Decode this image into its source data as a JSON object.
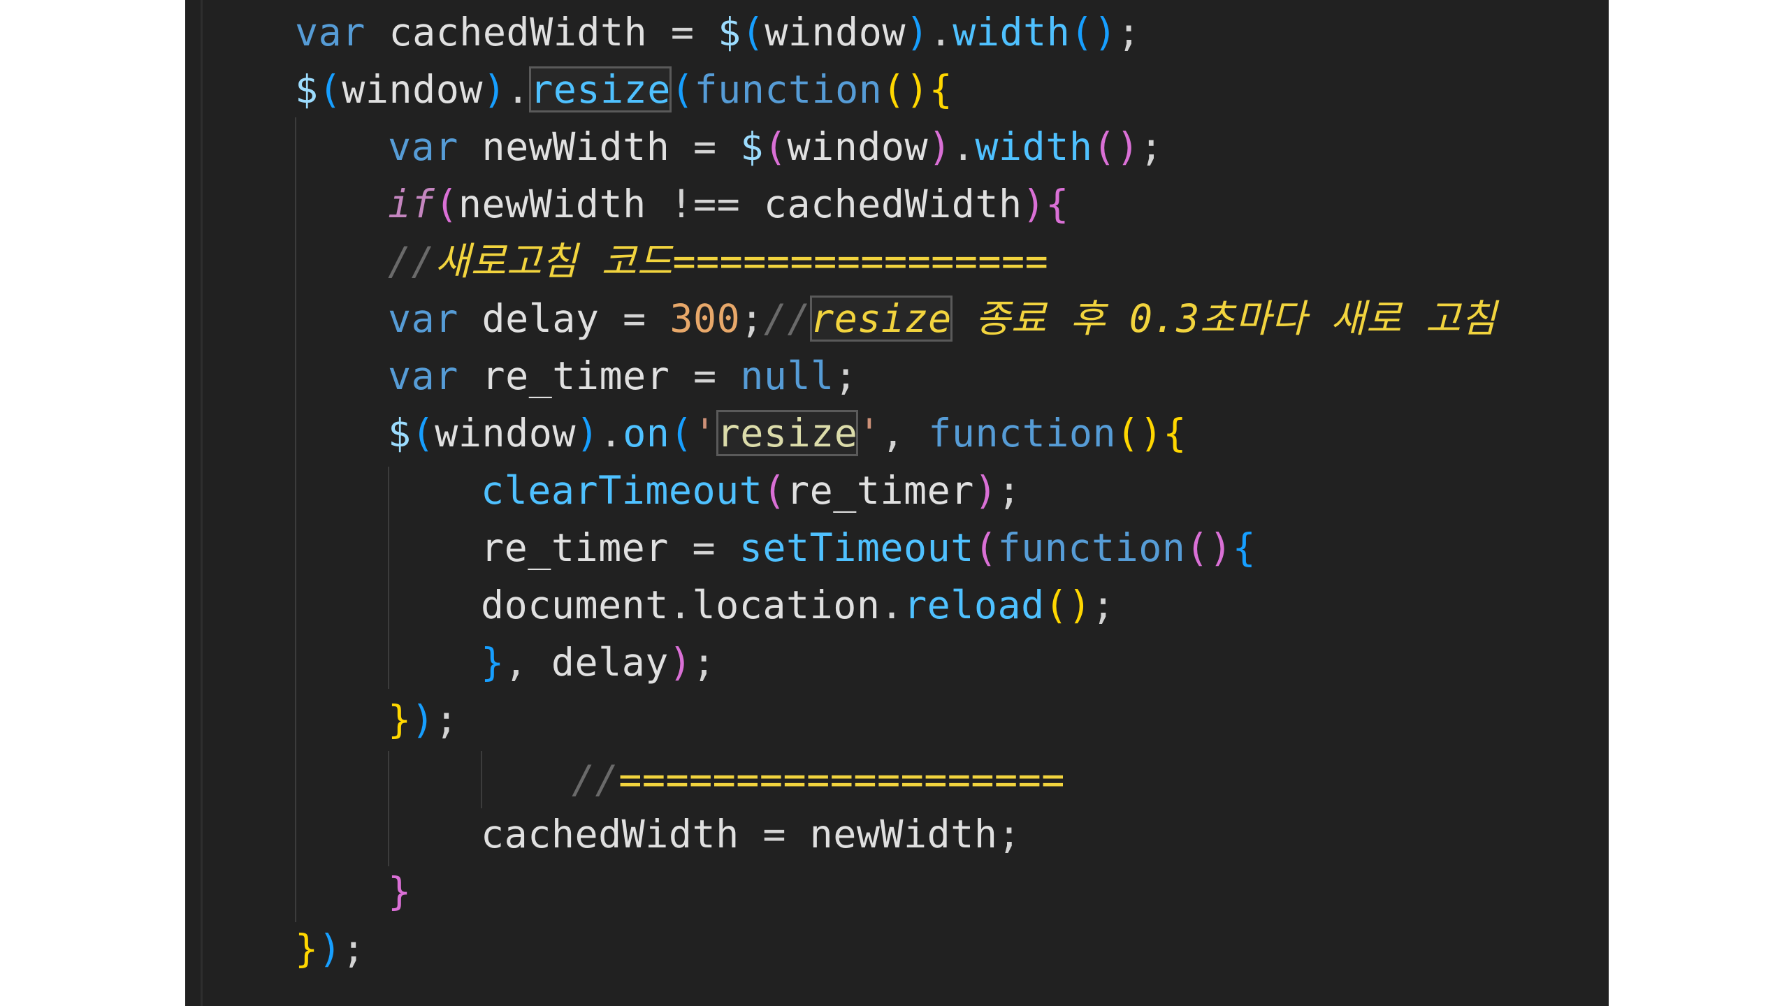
{
  "editor": {
    "lines": [
      {
        "tokens": [
          {
            "t": "var",
            "c": "kw"
          },
          {
            "t": " "
          },
          {
            "t": "cachedWidth",
            "c": "id"
          },
          {
            "t": " = ",
            "c": "op"
          },
          {
            "t": "$",
            "c": "var"
          },
          {
            "t": "(",
            "c": "b3"
          },
          {
            "t": "window",
            "c": "id"
          },
          {
            "t": ")",
            "c": "b3"
          },
          {
            "t": ".",
            "c": "op"
          },
          {
            "t": "width",
            "c": "mt"
          },
          {
            "t": "()",
            "c": "b3"
          },
          {
            "t": ";",
            "c": "op"
          }
        ]
      },
      {
        "tokens": [
          {
            "t": "$",
            "c": "var"
          },
          {
            "t": "(",
            "c": "b3"
          },
          {
            "t": "window",
            "c": "id"
          },
          {
            "t": ")",
            "c": "b3"
          },
          {
            "t": ".",
            "c": "op"
          },
          {
            "t": "resize",
            "c": "mt hl"
          },
          {
            "t": "(",
            "c": "b3"
          },
          {
            "t": "function",
            "c": "kw"
          },
          {
            "t": "()",
            "c": "b1"
          },
          {
            "t": "{",
            "c": "b1"
          }
        ]
      },
      {
        "tokens": [
          {
            "t": "var",
            "c": "kw"
          },
          {
            "t": " "
          },
          {
            "t": "newWidth",
            "c": "id"
          },
          {
            "t": " = ",
            "c": "op"
          },
          {
            "t": "$",
            "c": "var"
          },
          {
            "t": "(",
            "c": "b2"
          },
          {
            "t": "window",
            "c": "id"
          },
          {
            "t": ")",
            "c": "b2"
          },
          {
            "t": ".",
            "c": "op"
          },
          {
            "t": "width",
            "c": "mt"
          },
          {
            "t": "()",
            "c": "b2"
          },
          {
            "t": ";",
            "c": "op"
          }
        ]
      },
      {
        "tokens": [
          {
            "t": "if",
            "c": "ctl"
          },
          {
            "t": "(",
            "c": "b2"
          },
          {
            "t": "newWidth",
            "c": "id"
          },
          {
            "t": " !== ",
            "c": "op"
          },
          {
            "t": "cachedWidth",
            "c": "id"
          },
          {
            "t": ")",
            "c": "b2"
          },
          {
            "t": "{",
            "c": "b2"
          }
        ]
      },
      {
        "tokens": [
          {
            "t": "//",
            "c": "cmd"
          },
          {
            "t": "새로고침 코드================",
            "c": "cm"
          }
        ]
      },
      {
        "tokens": [
          {
            "t": "var",
            "c": "kw"
          },
          {
            "t": " "
          },
          {
            "t": "delay",
            "c": "id"
          },
          {
            "t": " = ",
            "c": "op"
          },
          {
            "t": "300",
            "c": "num"
          },
          {
            "t": ";",
            "c": "op"
          },
          {
            "t": "//",
            "c": "cmd"
          },
          {
            "t": "resize",
            "c": "cm hl"
          },
          {
            "t": " 종료 후 0.3초마다 새로 고침",
            "c": "cm"
          }
        ]
      },
      {
        "tokens": [
          {
            "t": "var",
            "c": "kw"
          },
          {
            "t": " "
          },
          {
            "t": "re_timer",
            "c": "id"
          },
          {
            "t": " = ",
            "c": "op"
          },
          {
            "t": "null",
            "c": "kw"
          },
          {
            "t": ";",
            "c": "op"
          }
        ]
      },
      {
        "tokens": [
          {
            "t": "$",
            "c": "var"
          },
          {
            "t": "(",
            "c": "b3"
          },
          {
            "t": "window",
            "c": "id"
          },
          {
            "t": ")",
            "c": "b3"
          },
          {
            "t": ".",
            "c": "op"
          },
          {
            "t": "on",
            "c": "mt"
          },
          {
            "t": "(",
            "c": "b3"
          },
          {
            "t": "'",
            "c": "str"
          },
          {
            "t": "resize",
            "c": "fn hl"
          },
          {
            "t": "'",
            "c": "str"
          },
          {
            "t": ", ",
            "c": "op"
          },
          {
            "t": "function",
            "c": "kw"
          },
          {
            "t": "()",
            "c": "b1"
          },
          {
            "t": "{",
            "c": "b1"
          }
        ]
      },
      {
        "tokens": [
          {
            "t": "clearTimeout",
            "c": "mt"
          },
          {
            "t": "(",
            "c": "b2"
          },
          {
            "t": "re_timer",
            "c": "id"
          },
          {
            "t": ")",
            "c": "b2"
          },
          {
            "t": ";",
            "c": "op"
          }
        ]
      },
      {
        "tokens": [
          {
            "t": "re_timer",
            "c": "id"
          },
          {
            "t": " = ",
            "c": "op"
          },
          {
            "t": "setTimeout",
            "c": "mt"
          },
          {
            "t": "(",
            "c": "b2"
          },
          {
            "t": "function",
            "c": "kw"
          },
          {
            "t": "()",
            "c": "b2"
          },
          {
            "t": "{",
            "c": "b3"
          }
        ]
      },
      {
        "tokens": [
          {
            "t": "document",
            "c": "id"
          },
          {
            "t": ".",
            "c": "op"
          },
          {
            "t": "location",
            "c": "id"
          },
          {
            "t": ".",
            "c": "op"
          },
          {
            "t": "reload",
            "c": "mt"
          },
          {
            "t": "()",
            "c": "b1"
          },
          {
            "t": ";",
            "c": "op"
          }
        ]
      },
      {
        "tokens": [
          {
            "t": "}",
            "c": "b3"
          },
          {
            "t": ", ",
            "c": "op"
          },
          {
            "t": "delay",
            "c": "id"
          },
          {
            "t": ")",
            "c": "b2"
          },
          {
            "t": ";",
            "c": "op"
          }
        ]
      },
      {
        "tokens": [
          {
            "t": "}",
            "c": "b1"
          },
          {
            "t": ")",
            "c": "b3"
          },
          {
            "t": ";",
            "c": "op"
          }
        ]
      },
      {
        "tokens": [
          {
            "t": "//",
            "c": "cmd"
          },
          {
            "t": "===================",
            "c": "cm"
          }
        ]
      },
      {
        "tokens": [
          {
            "t": "cachedWidth",
            "c": "id"
          },
          {
            "t": " = ",
            "c": "op"
          },
          {
            "t": "newWidth",
            "c": "id"
          },
          {
            "t": ";",
            "c": "op"
          }
        ]
      },
      {
        "tokens": [
          {
            "t": "}",
            "c": "b2"
          }
        ]
      },
      {
        "tokens": [
          {
            "t": "}",
            "c": "b1"
          },
          {
            "t": ")",
            "c": "b3"
          },
          {
            "t": ";",
            "c": "op"
          }
        ]
      }
    ]
  }
}
